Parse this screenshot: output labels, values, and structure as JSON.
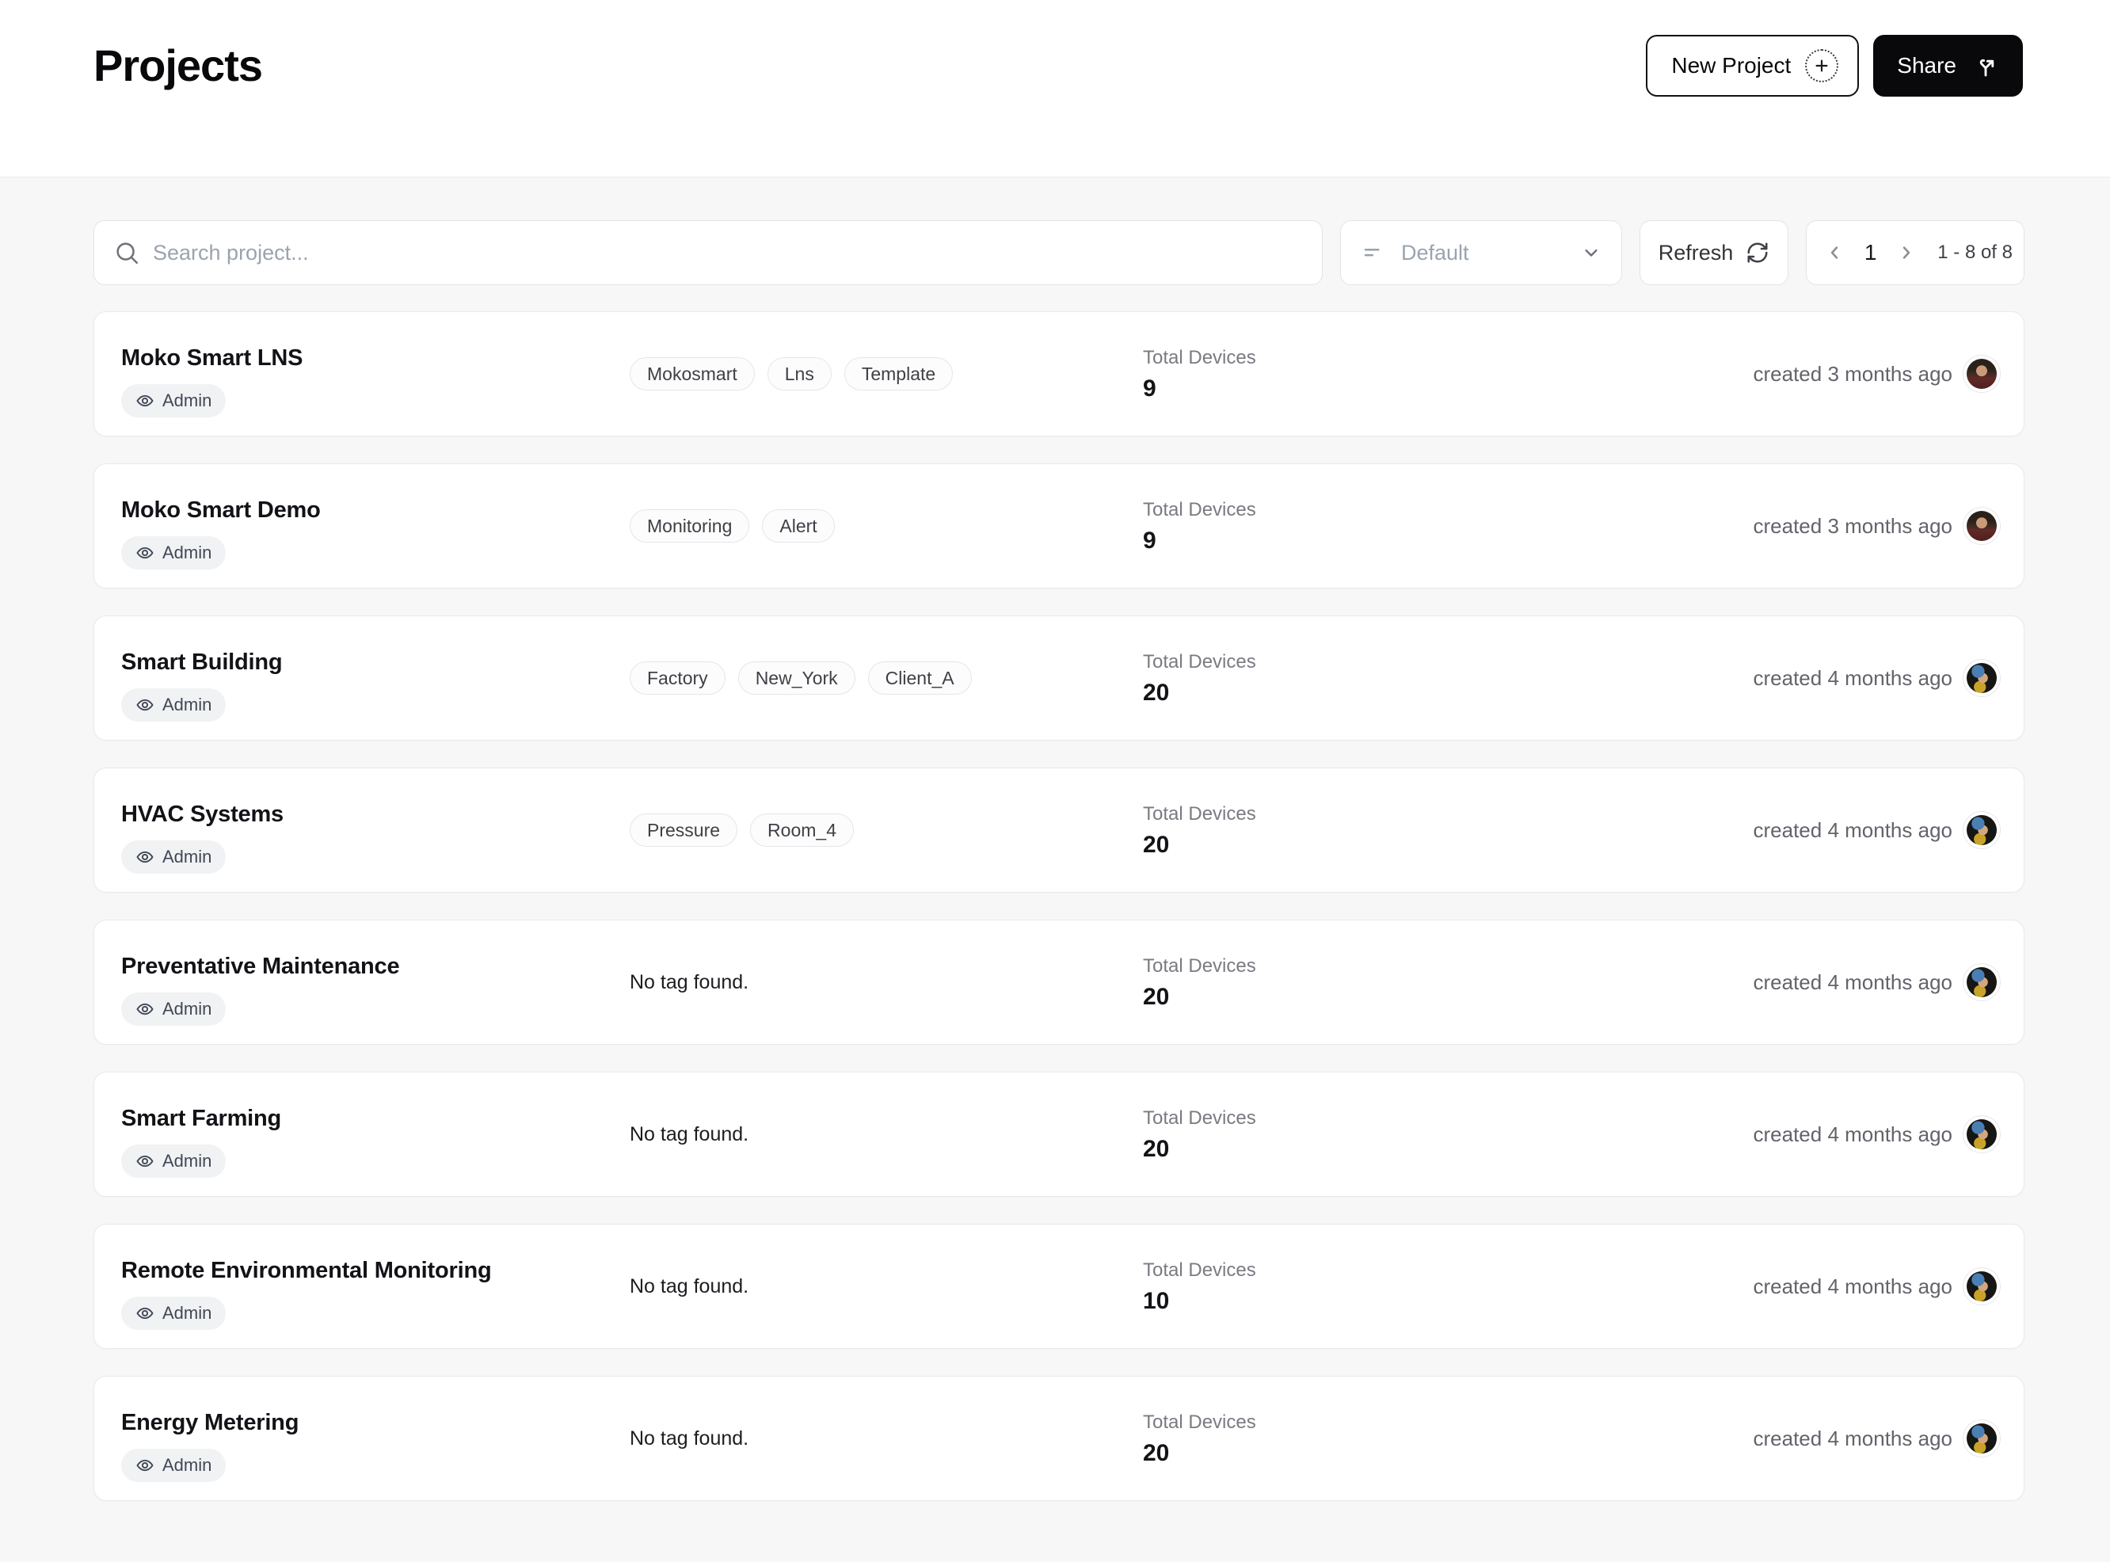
{
  "page": {
    "title": "Projects"
  },
  "header": {
    "new_project_label": "New Project",
    "share_label": "Share"
  },
  "toolbar": {
    "search_placeholder": "Search project...",
    "sort_value": "Default",
    "refresh_label": "Refresh",
    "pagination": {
      "page": "1",
      "range": "1 - 8 of 8"
    }
  },
  "labels": {
    "total_devices": "Total Devices",
    "no_tag": "No tag found."
  },
  "colors": {
    "accent_dark": "#09090b",
    "page_bg": "#f7f7f8",
    "card_border": "#e9e9eb",
    "badge_bg": "#f1f2f4"
  },
  "projects": [
    {
      "name": "Moko Smart LNS",
      "role": "Admin",
      "tags": [
        "Mokosmart",
        "Lns",
        "Template"
      ],
      "total_devices": "9",
      "created": "created 3 months ago",
      "avatar_variant": "maroon-portrait"
    },
    {
      "name": "Moko Smart Demo",
      "role": "Admin",
      "tags": [
        "Monitoring",
        "Alert"
      ],
      "total_devices": "9",
      "created": "created 3 months ago",
      "avatar_variant": "maroon-portrait"
    },
    {
      "name": "Smart Building",
      "role": "Admin",
      "tags": [
        "Factory",
        "New_York",
        "Client_A"
      ],
      "total_devices": "20",
      "created": "created 4 months ago",
      "avatar_variant": "pearl-portrait"
    },
    {
      "name": "HVAC Systems",
      "role": "Admin",
      "tags": [
        "Pressure",
        "Room_4"
      ],
      "total_devices": "20",
      "created": "created 4 months ago",
      "avatar_variant": "pearl-portrait"
    },
    {
      "name": "Preventative Maintenance",
      "role": "Admin",
      "tags": [],
      "total_devices": "20",
      "created": "created 4 months ago",
      "avatar_variant": "pearl-portrait"
    },
    {
      "name": "Smart Farming",
      "role": "Admin",
      "tags": [],
      "total_devices": "20",
      "created": "created 4 months ago",
      "avatar_variant": "pearl-portrait"
    },
    {
      "name": "Remote Environmental Monitoring",
      "role": "Admin",
      "tags": [],
      "total_devices": "10",
      "created": "created 4 months ago",
      "avatar_variant": "pearl-portrait"
    },
    {
      "name": "Energy Metering",
      "role": "Admin",
      "tags": [],
      "total_devices": "20",
      "created": "created 4 months ago",
      "avatar_variant": "pearl-portrait"
    }
  ]
}
